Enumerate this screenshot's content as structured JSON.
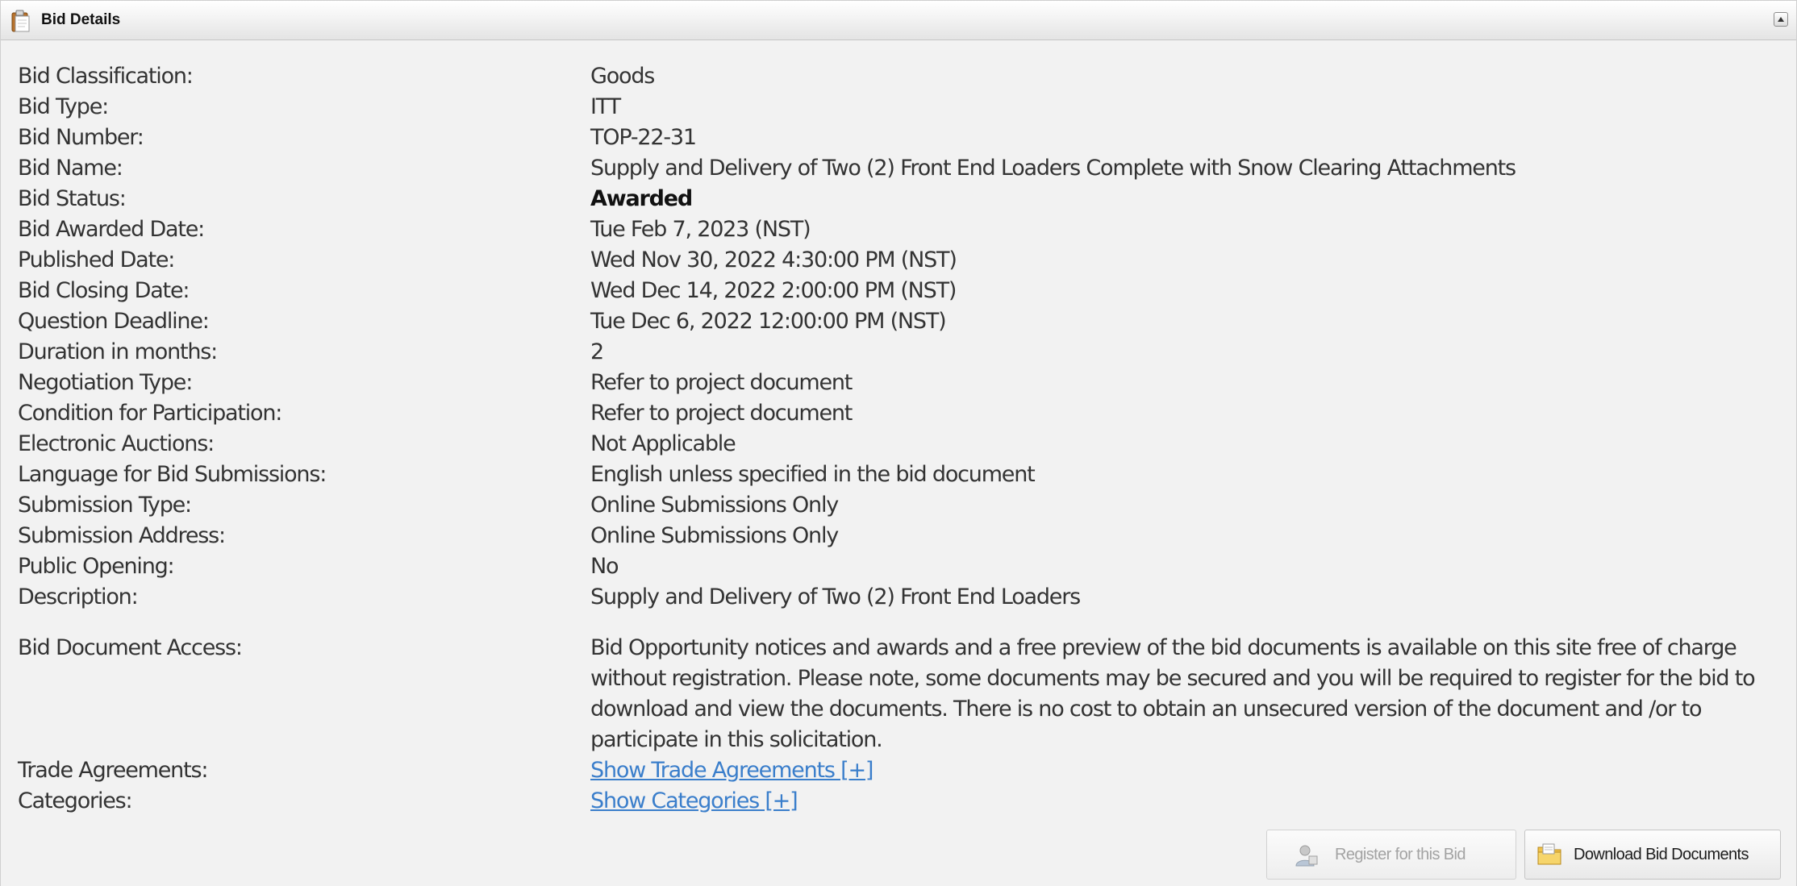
{
  "panel": {
    "title": "Bid Details",
    "icons": {
      "header": "clipboard-icon",
      "collapse": "collapse-up-icon"
    }
  },
  "fields": {
    "classification": {
      "label": "Bid Classification:",
      "value": "Goods"
    },
    "type": {
      "label": "Bid Type:",
      "value": "ITT"
    },
    "number": {
      "label": "Bid Number:",
      "value": "TOP-22-31"
    },
    "name": {
      "label": "Bid Name:",
      "value": "Supply and Delivery of Two (2) Front End Loaders Complete with Snow Clearing Attachments"
    },
    "status": {
      "label": "Bid Status:",
      "value": "Awarded"
    },
    "awarded_date": {
      "label": "Bid Awarded Date:",
      "value": "Tue Feb 7, 2023 (NST)"
    },
    "published_date": {
      "label": "Published Date:",
      "value": "Wed Nov 30, 2022 4:30:00 PM (NST)"
    },
    "closing_date": {
      "label": "Bid Closing Date:",
      "value": "Wed Dec 14, 2022 2:00:00 PM (NST)"
    },
    "question_deadline": {
      "label": "Question Deadline:",
      "value": "Tue Dec 6, 2022 12:00:00 PM (NST)"
    },
    "duration": {
      "label": "Duration in months:",
      "value": "2"
    },
    "negotiation_type": {
      "label": "Negotiation Type:",
      "value": "Refer to project document"
    },
    "condition": {
      "label": "Condition for Participation:",
      "value": "Refer to project document"
    },
    "auctions": {
      "label": "Electronic Auctions:",
      "value": "Not Applicable"
    },
    "language": {
      "label": "Language for Bid Submissions:",
      "value": "English unless specified in the bid document"
    },
    "submission_type": {
      "label": "Submission Type:",
      "value": "Online Submissions Only"
    },
    "submission_address": {
      "label": "Submission Address:",
      "value": "Online Submissions Only"
    },
    "public_opening": {
      "label": "Public Opening:",
      "value": "No"
    },
    "description": {
      "label": "Description:",
      "value": "Supply and Delivery of Two (2) Front End Loaders"
    },
    "document_access": {
      "label": "Bid Document Access:",
      "value": "Bid Opportunity notices and awards and a free preview of the bid documents is available on this site free of charge without registration. Please note, some documents may be secured and you will be required to register for the bid to download and view the documents. There is no cost to obtain an unsecured version of the document and /or to participate in this solicitation."
    },
    "trade_agreements": {
      "label": "Trade Agreements:",
      "link": "Show Trade Agreements [+]"
    },
    "categories": {
      "label": "Categories:",
      "link": "Show Categories [+]"
    }
  },
  "actions": {
    "register": {
      "label": "Register for this Bid",
      "icon": "user-register-icon",
      "enabled": false
    },
    "download": {
      "label": "Download Bid Documents",
      "icon": "folder-download-icon",
      "enabled": true
    }
  },
  "colors": {
    "link": "#3a7ecb",
    "text": "#333333",
    "background": "#f2f2f2"
  }
}
